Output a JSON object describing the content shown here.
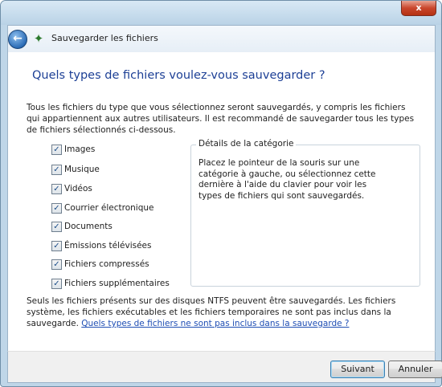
{
  "window": {
    "close_glyph": "x"
  },
  "navbar": {
    "back_glyph": "←",
    "wizard_title": "Sauvegarder les fichiers"
  },
  "main": {
    "heading": "Quels types de fichiers voulez-vous sauvegarder ?",
    "intro": "Tous les fichiers du type que vous sélectionnez seront sauvegardés, y compris les fichiers qui appartiennent aux autres utilisateurs. Il est recommandé de sauvegarder tous les types de fichiers sélectionnés ci-dessous.",
    "checkboxes": [
      {
        "label": "Images",
        "checked": true
      },
      {
        "label": "Musique",
        "checked": true
      },
      {
        "label": "Vidéos",
        "checked": true
      },
      {
        "label": "Courrier électronique",
        "checked": true
      },
      {
        "label": "Documents",
        "checked": true
      },
      {
        "label": "Émissions télévisées",
        "checked": true
      },
      {
        "label": "Fichiers compressés",
        "checked": true
      },
      {
        "label": "Fichiers supplémentaires",
        "checked": true
      }
    ],
    "details": {
      "legend": "Détails de la catégorie",
      "text": "Placez le pointeur de la souris sur une catégorie à gauche, ou sélectionnez cette dernière à l'aide du clavier pour voir les types de fichiers qui sont sauvegardés."
    },
    "footer_text": "Seuls les fichiers présents sur des disques NTFS peuvent être sauvegardés. Les fichiers système, les fichiers exécutables et les fichiers temporaires ne sont pas inclus dans la sauvegarde. ",
    "footer_link": "Quels types de fichiers ne sont pas inclus dans la sauvegarde ?"
  },
  "buttons": {
    "next": "Suivant",
    "cancel": "Annuler"
  },
  "colors": {
    "heading": "#1c3f95",
    "link": "#1f4eb4",
    "check": "#1d4f8a"
  }
}
